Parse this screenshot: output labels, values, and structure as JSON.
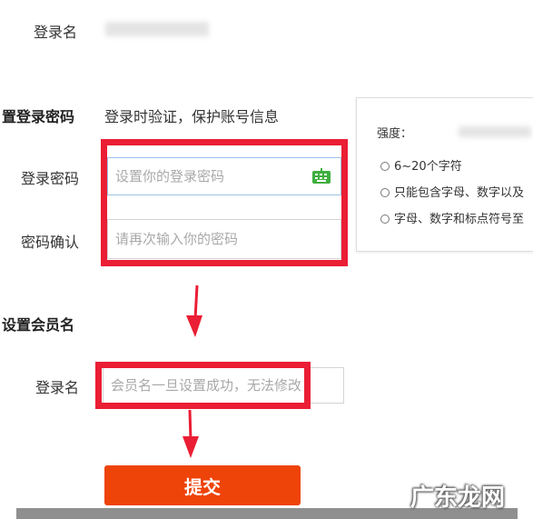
{
  "form": {
    "login_name_label": "登录名",
    "set_password_title": "置登录密码",
    "set_password_hint": "登录时验证，保护账号信息",
    "password_label": "登录密码",
    "password_placeholder": "设置你的登录密码",
    "confirm_label": "密码确认",
    "confirm_placeholder": "请再次输入你的密码",
    "member_title": "设置会员名",
    "member_login_label": "登录名",
    "member_placeholder": "会员名一旦设置成功，无法修改",
    "submit_label": "提交"
  },
  "password_tips": {
    "strength_label": "强度：",
    "rules": [
      "6~20个字符",
      "只能包含字母、数字以及",
      "字母、数字和标点符号至"
    ]
  },
  "watermark": "广东龙网",
  "colors": {
    "highlight_red": "#ea1e34",
    "submit_orange": "#ee4309",
    "input_focus_blue": "#9fc2ea",
    "keyboard_icon_green": "#3fae3f"
  },
  "icons": {
    "keyboard": "keyboard-icon",
    "arrow": "arrow-down-icon"
  }
}
